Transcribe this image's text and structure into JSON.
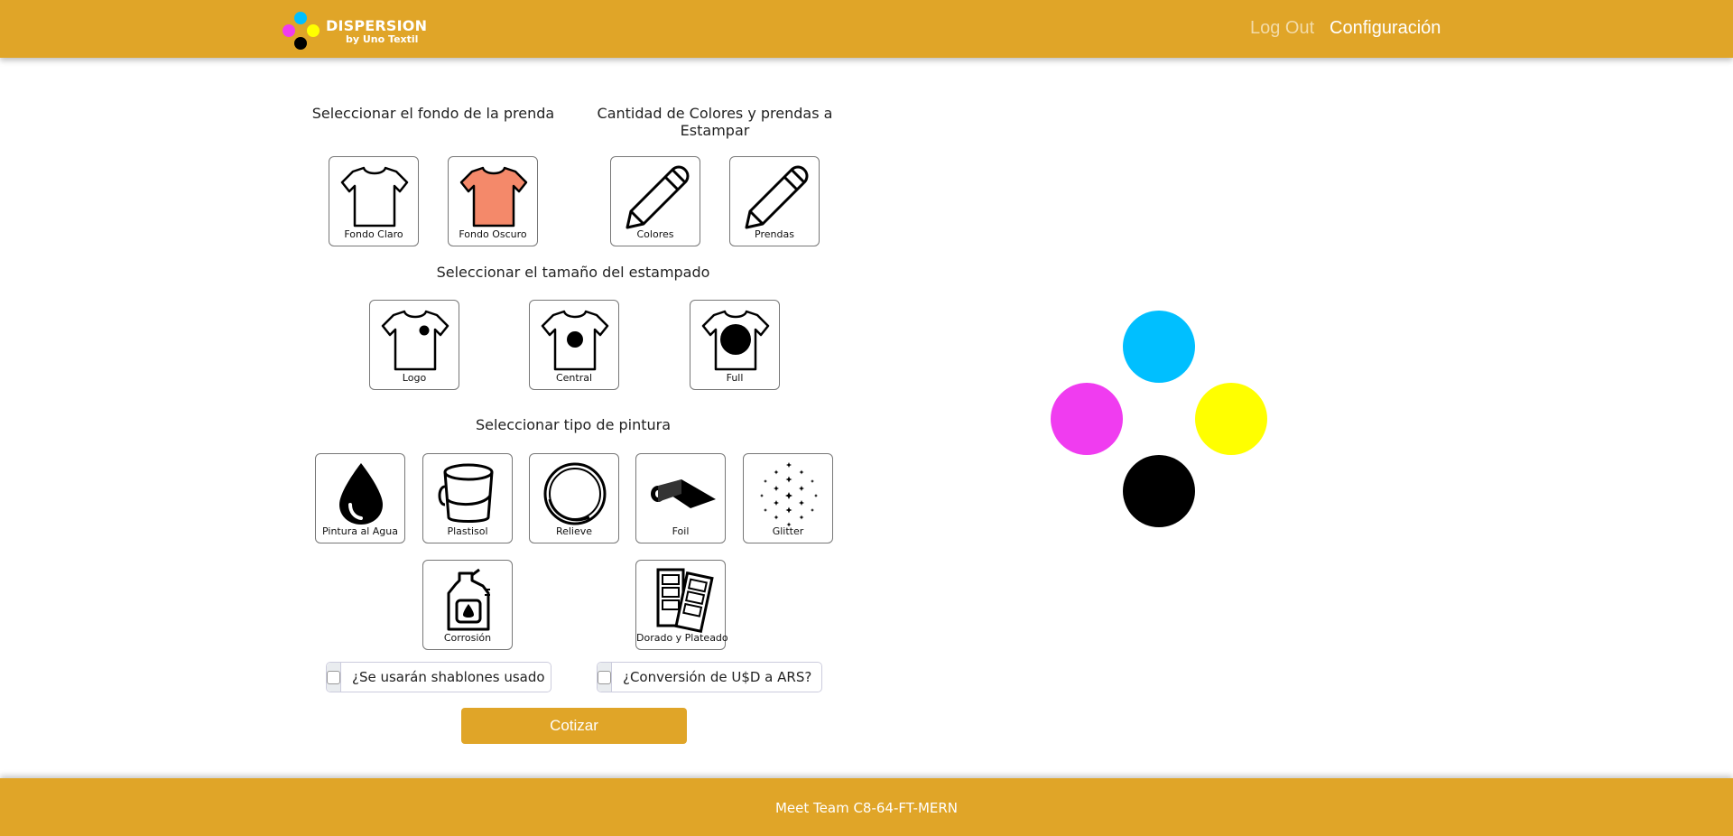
{
  "navbar": {
    "brand_title": "DISPERSION",
    "brand_subtitle": "by Uno Textil",
    "logout_label": "Log Out",
    "config_label": "Configuración",
    "color": "#e0a528"
  },
  "sections": {
    "fondo_title": "Seleccionar el fondo de la prenda",
    "cantidad_title": "Cantidad de Colores y prendas a Estampar",
    "tamano_title": "Seleccionar el tamaño del estampado",
    "pintura_title": "Seleccionar tipo de pintura"
  },
  "fondo_options": [
    {
      "label": "Fondo Claro",
      "icon": "tshirt-light-icon"
    },
    {
      "label": "Fondo Oscuro",
      "icon": "tshirt-dark-icon"
    }
  ],
  "cantidad_options": [
    {
      "label": "Colores",
      "icon": "pencil-icon"
    },
    {
      "label": "Prendas",
      "icon": "pencil-icon"
    }
  ],
  "tamano_options": [
    {
      "label": "Logo",
      "icon": "tshirt-logo-icon"
    },
    {
      "label": "Central",
      "icon": "tshirt-central-icon"
    },
    {
      "label": "Full",
      "icon": "tshirt-full-icon"
    }
  ],
  "pintura_options": [
    {
      "label": "Pintura al Agua",
      "icon": "water-drop-icon"
    },
    {
      "label": "Plastisol",
      "icon": "bucket-icon"
    },
    {
      "label": "Relieve",
      "icon": "ring-icon"
    },
    {
      "label": "Foil",
      "icon": "foil-roll-icon"
    },
    {
      "label": "Glitter",
      "icon": "sparkles-icon"
    },
    {
      "label": "Corrosión",
      "icon": "chemical-bottle-icon"
    },
    {
      "label": "Dorado y Plateado",
      "icon": "metallic-sheets-icon"
    }
  ],
  "checkboxes": {
    "shablones_label": "¿Se usarán shablones usado",
    "conversion_label": "¿Conversión de U$D a ARS?"
  },
  "cotizar_label": "Cotizar",
  "footer_text": "Meet Team C8-64-FT-MERN",
  "colors": {
    "cyan": "#00bfff",
    "magenta": "#f03cf0",
    "yellow": "#ffff00",
    "black": "#000000",
    "accent": "#e0a528"
  }
}
